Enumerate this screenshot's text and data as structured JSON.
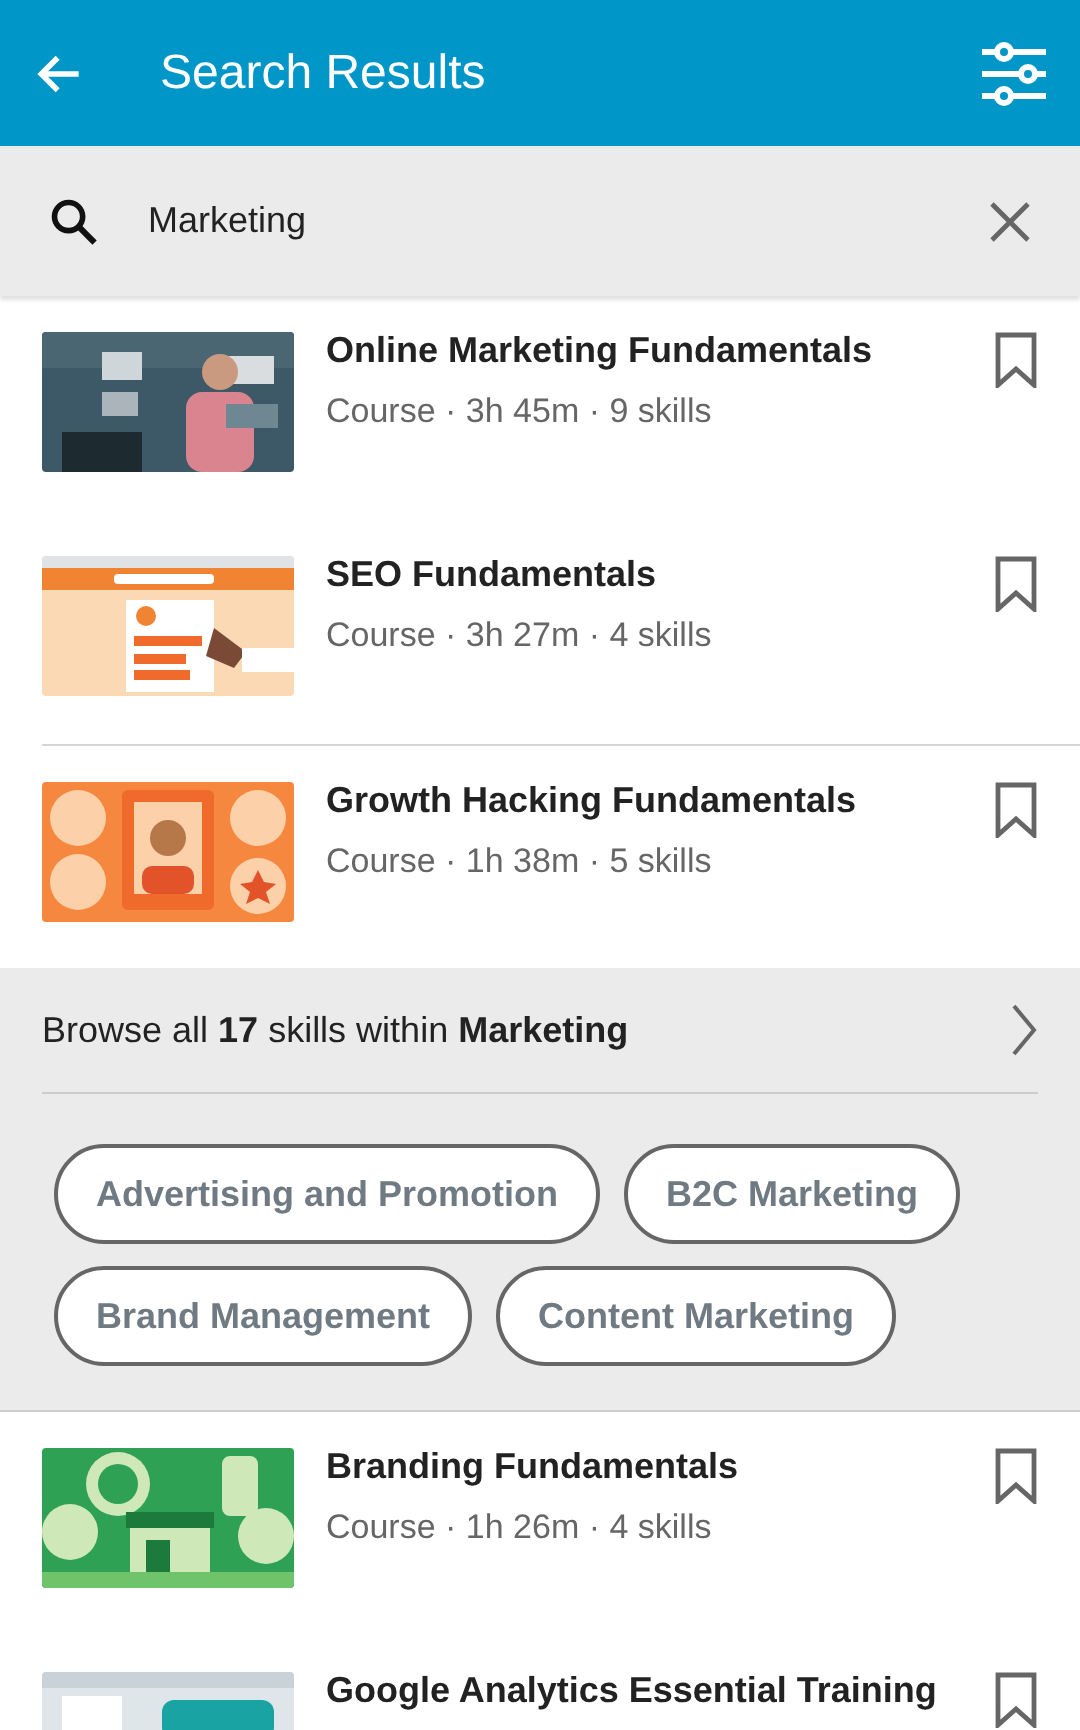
{
  "header": {
    "title": "Search Results"
  },
  "search": {
    "value": "Marketing"
  },
  "results": [
    {
      "title": "Online Marketing Fundamentals",
      "meta": "Course · 3h 45m · 9 skills",
      "divider_above": false
    },
    {
      "title": "SEO Fundamentals",
      "meta": "Course · 3h 27m · 4 skills",
      "divider_above": false
    },
    {
      "title": "Growth Hacking Fundamentals",
      "meta": "Course · 1h 38m · 5 skills",
      "divider_above": true
    }
  ],
  "browse": {
    "text": "Browse all **17** skills within **Marketing**",
    "skills": [
      "Advertising and Promotion",
      "B2C Marketing",
      "Brand Management",
      "Content Marketing"
    ]
  },
  "more_results": [
    {
      "title": "Branding Fundamentals",
      "meta": "Course · 1h 26m · 4 skills",
      "divider_above": false
    },
    {
      "title": "Google Analytics Essential Training",
      "divider_above": false
    }
  ]
}
